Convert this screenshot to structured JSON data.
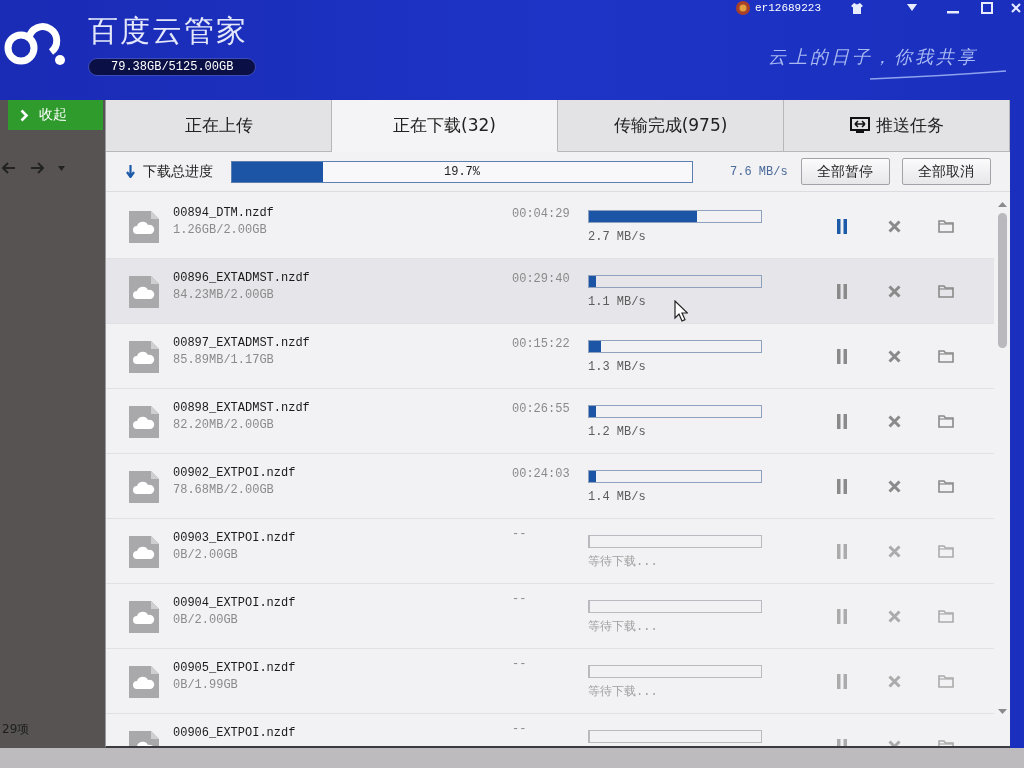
{
  "header": {
    "title": "百度云管家",
    "storage": "79.38GB/5125.00GB",
    "username": "er12689223",
    "slogan": "云上的日子，你我共享"
  },
  "sidebar": {
    "collapse_button": "收起",
    "item_count": "29项"
  },
  "tabs": [
    {
      "label": "正在上传",
      "selected": false,
      "kind": "transfer"
    },
    {
      "label": "正在下载(32)",
      "selected": true,
      "kind": "transfer"
    },
    {
      "label": "传输完成(975)",
      "selected": false,
      "kind": "transfer"
    },
    {
      "label": "推送任务",
      "selected": false,
      "kind": "push"
    }
  ],
  "overall": {
    "label": "下载总进度",
    "level": 0.197,
    "percent": "19.7%",
    "speed": "7.6 MB/s",
    "buttons": [
      "全部暂停",
      "全部取消"
    ]
  },
  "downloads": [
    {
      "kind": "downloading",
      "name": "00894_DTM.nzdf",
      "size": "1.26GB/2.00GB",
      "time_left": "00:04:29",
      "level": 0.63,
      "status": "2.7 MB/s",
      "hovered": false,
      "pause_highlighted": true
    },
    {
      "kind": "downloading",
      "name": "00896_EXTADMST.nzdf",
      "size": "84.23MB/2.00GB",
      "time_left": "00:29:40",
      "level": 0.04,
      "status": "1.1 MB/s",
      "hovered": true,
      "pause_highlighted": false
    },
    {
      "kind": "downloading",
      "name": "00897_EXTADMST.nzdf",
      "size": "85.89MB/1.17GB",
      "time_left": "00:15:22",
      "level": 0.07,
      "status": "1.3 MB/s",
      "hovered": false,
      "pause_highlighted": false
    },
    {
      "kind": "downloading",
      "name": "00898_EXTADMST.nzdf",
      "size": "82.20MB/2.00GB",
      "time_left": "00:26:55",
      "level": 0.04,
      "status": "1.2 MB/s",
      "hovered": false,
      "pause_highlighted": false
    },
    {
      "kind": "downloading",
      "name": "00902_EXTPOI.nzdf",
      "size": "78.68MB/2.00GB",
      "time_left": "00:24:03",
      "level": 0.04,
      "status": "1.4 MB/s",
      "hovered": false,
      "pause_highlighted": false
    },
    {
      "kind": "waiting",
      "name": "00903_EXTPOI.nzdf",
      "size": "0B/2.00GB",
      "time_left": "--",
      "level": 0,
      "status": "等待下载...",
      "hovered": false,
      "pause_highlighted": false
    },
    {
      "kind": "waiting",
      "name": "00904_EXTPOI.nzdf",
      "size": "0B/2.00GB",
      "time_left": "--",
      "level": 0,
      "status": "等待下载...",
      "hovered": false,
      "pause_highlighted": false
    },
    {
      "kind": "waiting",
      "name": "00905_EXTPOI.nzdf",
      "size": "0B/1.99GB",
      "time_left": "--",
      "level": 0,
      "status": "等待下载...",
      "hovered": false,
      "pause_highlighted": false
    },
    {
      "kind": "waiting",
      "name": "00906_EXTPOI.nzdf",
      "time_left": "--",
      "level": 0,
      "hovered": false,
      "pause_highlighted": false
    }
  ]
}
